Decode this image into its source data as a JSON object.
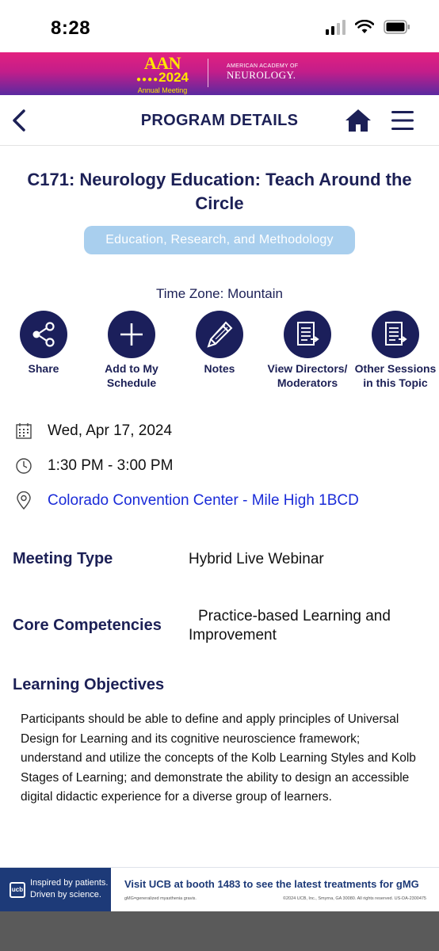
{
  "status_bar": {
    "time": "8:28"
  },
  "banner": {
    "event_logo_top": "AAN",
    "event_logo_year": "2024",
    "event_logo_sub": "Annual Meeting",
    "org_logo_top": "AMERICAN ACADEMY OF",
    "org_logo_main": "NEUROLOGY."
  },
  "nav": {
    "title": "PROGRAM DETAILS"
  },
  "session": {
    "title": "C171: Neurology Education: Teach Around the Circle",
    "topic_badge": "Education, Research, and Methodology",
    "time_zone": "Time Zone: Mountain"
  },
  "actions": [
    {
      "label": "Share",
      "icon": "share-icon"
    },
    {
      "label": "Add to My Schedule",
      "icon": "plus-icon"
    },
    {
      "label": "Notes",
      "icon": "pencil-icon"
    },
    {
      "label": "View Directors/ Moderators",
      "icon": "document-arrow-icon"
    },
    {
      "label": "Other Sessions in this Topic",
      "icon": "document-arrow-icon"
    }
  ],
  "details": {
    "date": "Wed, Apr 17, 2024",
    "time": "1:30 PM - 3:00 PM",
    "location": "Colorado Convention Center - Mile High 1BCD"
  },
  "fields": {
    "meeting_type_label": "Meeting Type",
    "meeting_type_value": "Hybrid Live Webinar",
    "core_competencies_label": "Core Competencies",
    "core_competencies_value": "Practice-based Learning and Improvement",
    "learning_objectives_label": "Learning Objectives",
    "learning_objectives_text": "Participants should be able to define and apply principles of Universal Design for Learning and its cognitive neuroscience framework; understand and utilize the concepts of the Kolb Learning Styles and Kolb Stages of Learning; and demonstrate the ability to design an accessible digital didactic experience for a diverse group of learners."
  },
  "ad": {
    "brand_line1": "Inspired by patients.",
    "brand_line2": "Driven by science.",
    "brand_logo": "ucb",
    "headline": "Visit UCB at booth 1483 to see the latest treatments for gMG",
    "footnote": "gMG=generalized myasthenia gravis.",
    "legal": "©2024 UCB, Inc., Smyrna, GA 30080. All rights reserved. US-DA-2300475"
  },
  "colors": {
    "navy": "#1c2056",
    "action_circle": "#1b1f5b",
    "badge": "#a9cfee",
    "link": "#1a2bd8",
    "banner_pink": "#e3217f",
    "banner_purple": "#5a2aa0",
    "ad_navy": "#1d3a78"
  }
}
